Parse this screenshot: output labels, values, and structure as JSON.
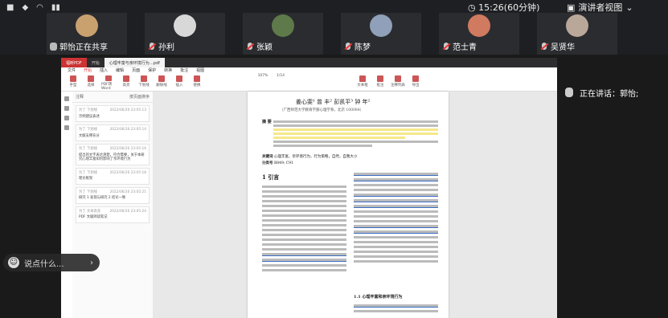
{
  "system": {
    "clock": "15:26(60分钟)",
    "presenter_view": "演讲者视图"
  },
  "participants": [
    {
      "name": "郭怡正在共享",
      "mic": "on"
    },
    {
      "name": "孙利",
      "mic": "off"
    },
    {
      "name": "张颖",
      "mic": "off"
    },
    {
      "name": "陈梦",
      "mic": "off"
    },
    {
      "name": "范士青",
      "mic": "off"
    },
    {
      "name": "吴贤华",
      "mic": "off"
    }
  ],
  "speaking": "正在讲话：郭怡;",
  "chat_placeholder": "说点什么...",
  "pdf": {
    "tabs": [
      "福昕PDF",
      "开始",
      "心理丰富与亲环境行为…pdf"
    ],
    "menu": [
      "文件",
      "开始",
      "插入",
      "编辑",
      "页面",
      "保护",
      "转换",
      "批注",
      "视图"
    ],
    "tools": [
      "手型",
      "选择",
      "PDF转Word",
      "高亮",
      "下划线",
      "删除线",
      "插入",
      "替换",
      "文本框",
      "批注",
      "注释列表",
      "导出"
    ],
    "zoom": "107%",
    "page_indicator": "1/14",
    "panel_title": "注释",
    "panel_sort": "按页面排序",
    "comments": [
      {
        "author": "为了 下划线",
        "time": "2022/06/20 23:05:13",
        "body": "示例建议表述"
      },
      {
        "author": "为了 下划线",
        "time": "2022/06/20 23:05:14",
        "body": "文献支撑充分"
      },
      {
        "author": "为了 下划线",
        "time": "2022/06/20 23:05:16",
        "body": "提出的文字表达清楚，符合需要，关于本研究心理丰富如何影响了亲环境行为"
      },
      {
        "author": "为了 下划线",
        "time": "2022/06/20 23:05:18",
        "body": "理论框架"
      },
      {
        "author": "为了 下划线",
        "time": "2022/06/20 23:05:21",
        "body": "研究 1 发现与研究 2 结论一致"
      },
      {
        "author": "为了 文本高亮",
        "time": "2022/06/20 23:05:24",
        "body": "PDF 文献阅读笔记"
      }
    ],
    "paper": {
      "authors": "姜心雯¹  曾 丰²  彭凯平³  钟 年²",
      "affil": "（广西师范大学教育学部心理学系，北京 100084）",
      "abstract_label": "摘 要",
      "keywords_label": "关键词",
      "keywords": "心理丰富，亲环境行为，行为策略，自然，自我大小",
      "class_label": "分类号",
      "class": "B849; C91",
      "section": "1 引言",
      "subsection": "1.1 心理丰富和亲环境行为"
    }
  }
}
